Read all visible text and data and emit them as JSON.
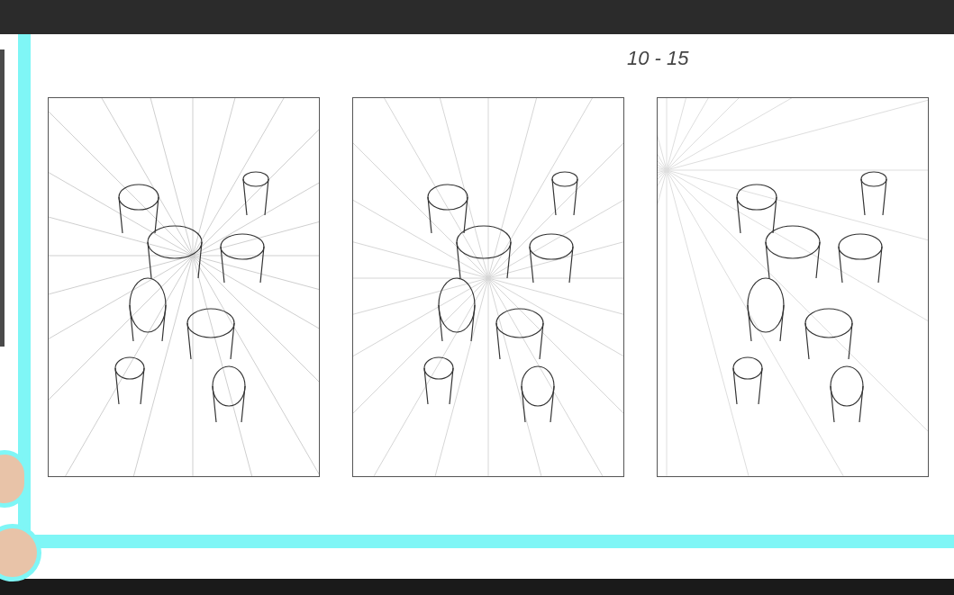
{
  "canvas": {
    "note": "10 - 15"
  }
}
